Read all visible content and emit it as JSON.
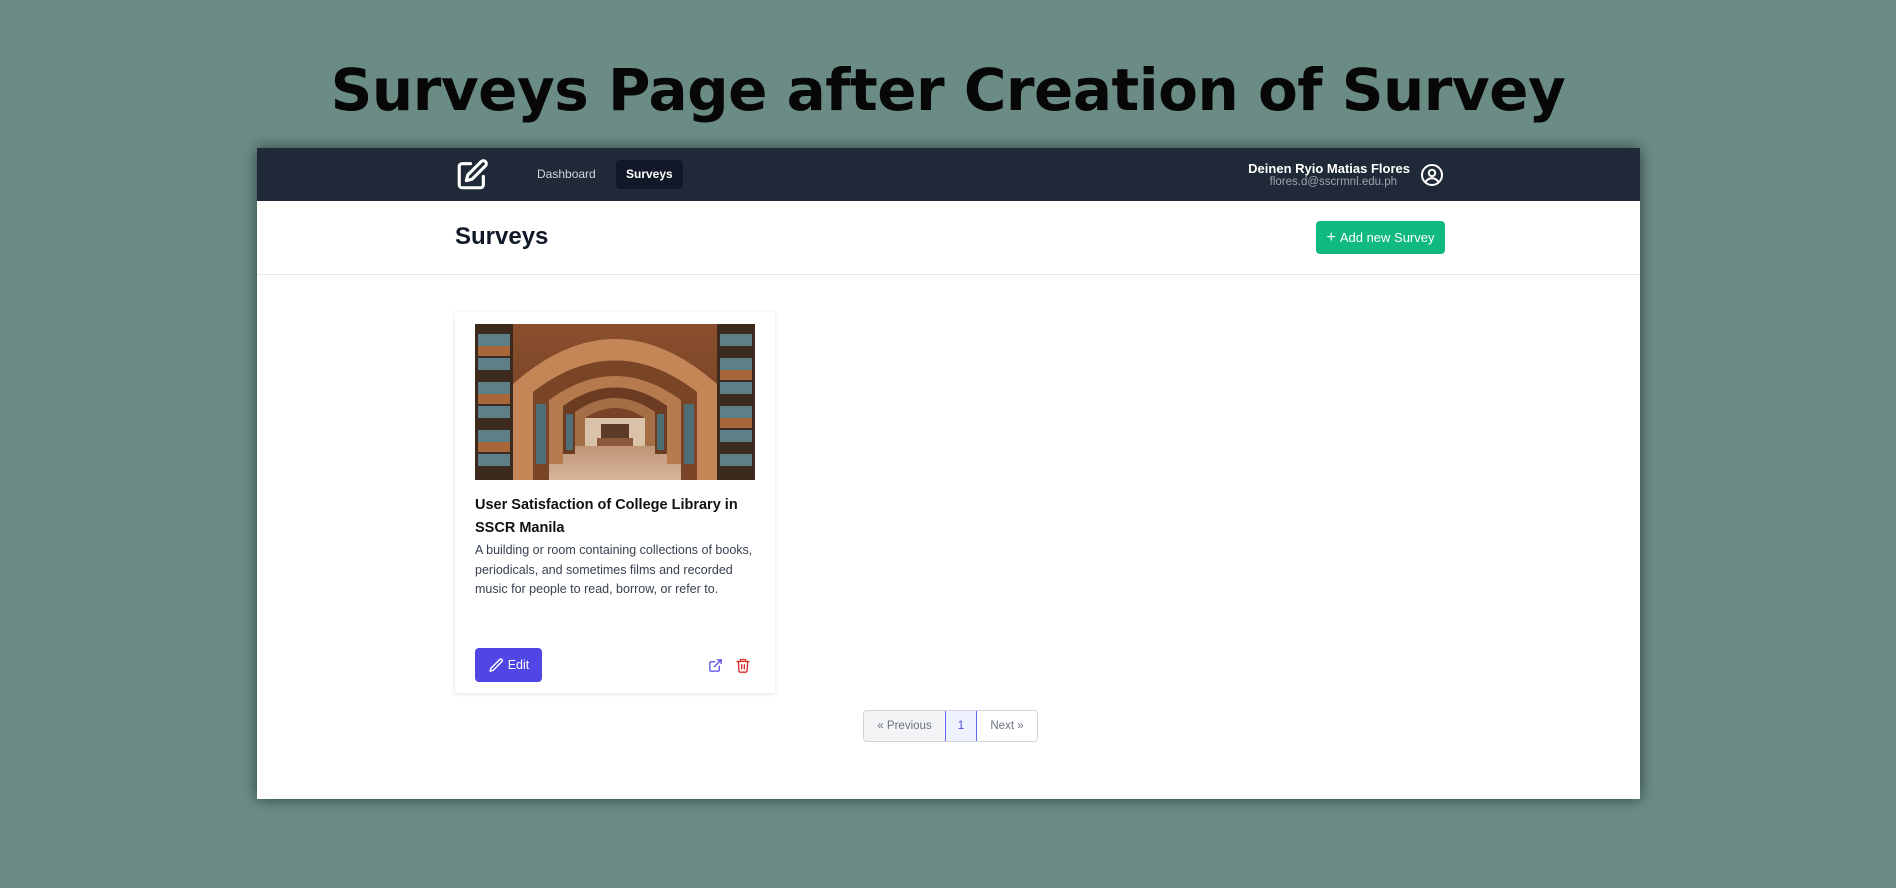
{
  "slide": {
    "title": "Surveys Page after Creation of Survey"
  },
  "navbar": {
    "links": [
      {
        "label": "Dashboard",
        "active": false
      },
      {
        "label": "Surveys",
        "active": true
      }
    ],
    "user": {
      "name": "Deinen Ryio Matias Flores",
      "email": "flores.d@sscrmnl.edu.ph"
    },
    "icons": {
      "logo": "pencil-square-icon",
      "avatar": "user-circle-icon"
    }
  },
  "header": {
    "title": "Surveys",
    "add_button": "Add new Survey"
  },
  "surveys": [
    {
      "title": "User Satisfaction of College Library in SSCR Manila",
      "description": "A building or room containing collections of books, periodicals, and sometimes films and recorded music for people to read, borrow, or refer to.",
      "edit_label": "Edit",
      "image": "library-interior-photo"
    }
  ],
  "pagination": {
    "previous": "« Previous",
    "current": "1",
    "next": "Next »"
  },
  "colors": {
    "navbar": "#1f2937",
    "accent_green": "#10b981",
    "accent_indigo": "#4f46e5",
    "danger": "#dc2626",
    "slide_background": "#6b8c85"
  }
}
